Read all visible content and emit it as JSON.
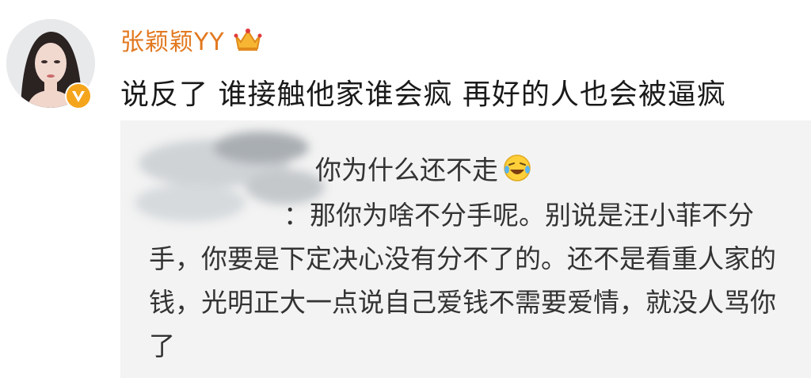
{
  "post": {
    "username": "张颖颖YY",
    "comment": "说反了 谁接触他家谁会疯 再好的人也会被逼疯"
  },
  "quoted": {
    "line1": "你为什么还不走",
    "reply_prefix": "：",
    "reply": "那你为啥不分手呢。别说是汪小菲不分手，你要是下定决心没有分不了的。还不是看重人家的钱，光明正大一点说自己爱钱不需要爱情，就没人骂你了"
  },
  "colors": {
    "username": "#e2781f",
    "badge": "#f4a51c",
    "quote_bg": "#f3f3f3"
  },
  "icons": {
    "avatar": "user-avatar",
    "verified": "verified-badge-icon",
    "crown": "crown-icon",
    "emoji": "laugh-cry-emoji-icon"
  }
}
